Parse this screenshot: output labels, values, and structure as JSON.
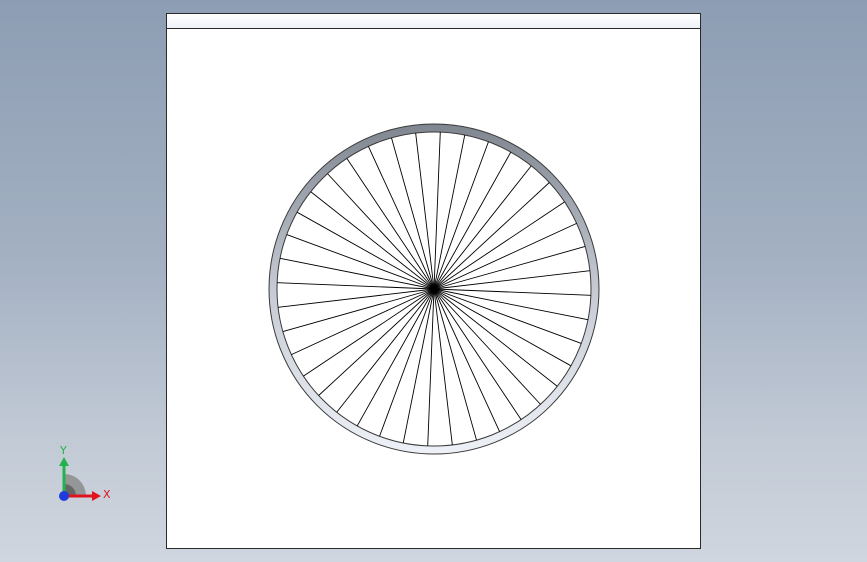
{
  "viewport": {
    "wheel": {
      "spoke_count": 40,
      "colors": {
        "rim_dark": "#7f8690",
        "rim_mid": "#c5cad3",
        "rim_light": "#eef1f7",
        "spoke": "#000000"
      }
    }
  },
  "triad": {
    "x_label": "X",
    "y_label": "Y",
    "colors": {
      "x_axis": "#e0141e",
      "y_axis": "#22b24c",
      "z_axis": "#1e3cdc",
      "arc": "#8c8c8c"
    }
  }
}
